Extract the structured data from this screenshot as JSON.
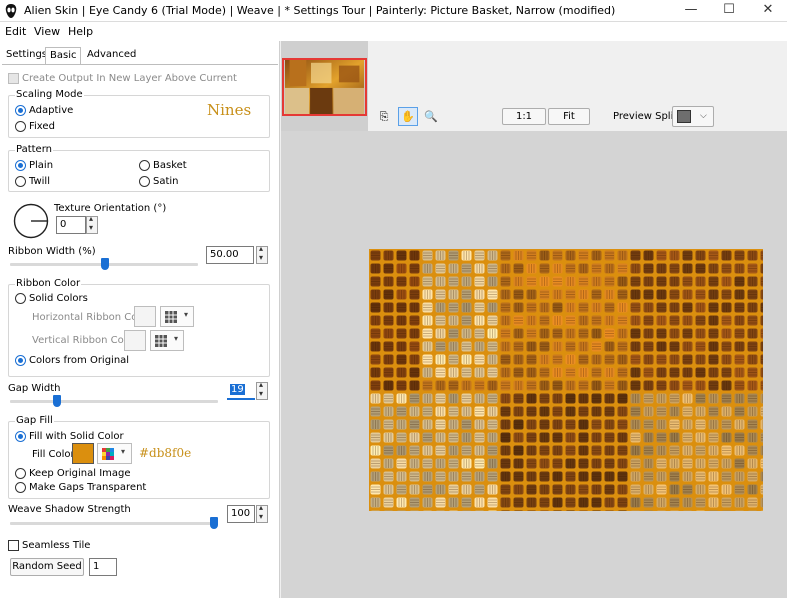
{
  "window": {
    "title": "Alien Skin | Eye Candy 6 (Trial Mode) | Weave | * Settings Tour | Painterly: Picture Basket, Narrow (modified)"
  },
  "menu": [
    "Edit",
    "View",
    "Help"
  ],
  "tabs": [
    "Settings",
    "Basic",
    "Advanced"
  ],
  "create_output_label": "Create Output In New Layer Above Current",
  "scaling_mode": {
    "title": "Scaling Mode",
    "options": [
      "Adaptive",
      "Fixed"
    ],
    "selected": "Adaptive",
    "annotation": "Nines"
  },
  "pattern": {
    "title": "Pattern",
    "options": [
      "Plain",
      "Basket",
      "Twill",
      "Satin"
    ],
    "selected": "Plain"
  },
  "texture_orientation": {
    "label": "Texture Orientation (°)",
    "value": "0"
  },
  "ribbon_width": {
    "label": "Ribbon Width (%)",
    "value": "50.00",
    "level_fraction": 0.5
  },
  "ribbon_color": {
    "title": "Ribbon Color",
    "solid_label": "Solid Colors",
    "horizontal_label": "Horizontal Ribbon Color",
    "vertical_label": "Vertical Ribbon Color",
    "original_label": "Colors from Original",
    "selected": "Colors from Original"
  },
  "gap_width": {
    "label": "Gap Width",
    "value": "19",
    "level_fraction": 0.19
  },
  "gap_fill": {
    "title": "Gap Fill",
    "solid_label": "Fill with Solid Color",
    "fill_color_label": "Fill Color",
    "fill_color": "#db8f0e",
    "fill_color_annotation": "#db8f0e",
    "keep_label": "Keep Original Image",
    "transparent_label": "Make Gaps Transparent",
    "selected": "Fill with Solid Color"
  },
  "shadow": {
    "label": "Weave Shadow Strength",
    "value": "100",
    "level_fraction": 1.0
  },
  "seamless_label": "Seamless Tile",
  "random_seed": {
    "button": "Random Seed",
    "value": "1"
  },
  "preview_toolbar": {
    "zoom_one": "1:1",
    "fit": "Fit",
    "split_label": "Preview Split:"
  },
  "colors": {
    "accent": "#1a6fd4",
    "thumb_border": "#e53935",
    "annotation": "#c8901a"
  }
}
